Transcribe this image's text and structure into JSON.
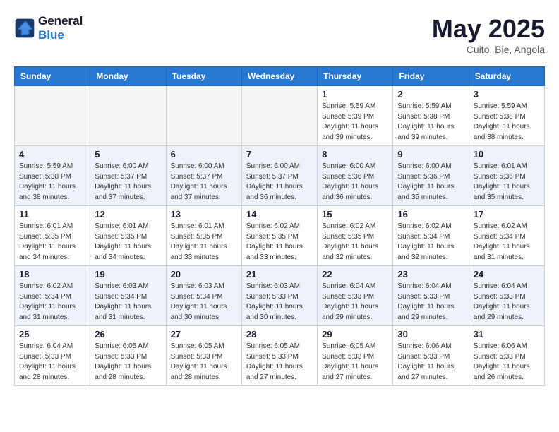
{
  "header": {
    "logo_line1": "General",
    "logo_line2": "Blue",
    "month_year": "May 2025",
    "location": "Cuito, Bie, Angola"
  },
  "weekdays": [
    "Sunday",
    "Monday",
    "Tuesday",
    "Wednesday",
    "Thursday",
    "Friday",
    "Saturday"
  ],
  "rows": [
    {
      "alt": false,
      "cells": [
        {
          "empty": true
        },
        {
          "empty": true
        },
        {
          "empty": true
        },
        {
          "empty": true
        },
        {
          "day": "1",
          "info": "Sunrise: 5:59 AM\nSunset: 5:39 PM\nDaylight: 11 hours\nand 39 minutes."
        },
        {
          "day": "2",
          "info": "Sunrise: 5:59 AM\nSunset: 5:38 PM\nDaylight: 11 hours\nand 39 minutes."
        },
        {
          "day": "3",
          "info": "Sunrise: 5:59 AM\nSunset: 5:38 PM\nDaylight: 11 hours\nand 38 minutes."
        }
      ]
    },
    {
      "alt": true,
      "cells": [
        {
          "day": "4",
          "info": "Sunrise: 5:59 AM\nSunset: 5:38 PM\nDaylight: 11 hours\nand 38 minutes."
        },
        {
          "day": "5",
          "info": "Sunrise: 6:00 AM\nSunset: 5:37 PM\nDaylight: 11 hours\nand 37 minutes."
        },
        {
          "day": "6",
          "info": "Sunrise: 6:00 AM\nSunset: 5:37 PM\nDaylight: 11 hours\nand 37 minutes."
        },
        {
          "day": "7",
          "info": "Sunrise: 6:00 AM\nSunset: 5:37 PM\nDaylight: 11 hours\nand 36 minutes."
        },
        {
          "day": "8",
          "info": "Sunrise: 6:00 AM\nSunset: 5:36 PM\nDaylight: 11 hours\nand 36 minutes."
        },
        {
          "day": "9",
          "info": "Sunrise: 6:00 AM\nSunset: 5:36 PM\nDaylight: 11 hours\nand 35 minutes."
        },
        {
          "day": "10",
          "info": "Sunrise: 6:01 AM\nSunset: 5:36 PM\nDaylight: 11 hours\nand 35 minutes."
        }
      ]
    },
    {
      "alt": false,
      "cells": [
        {
          "day": "11",
          "info": "Sunrise: 6:01 AM\nSunset: 5:35 PM\nDaylight: 11 hours\nand 34 minutes."
        },
        {
          "day": "12",
          "info": "Sunrise: 6:01 AM\nSunset: 5:35 PM\nDaylight: 11 hours\nand 34 minutes."
        },
        {
          "day": "13",
          "info": "Sunrise: 6:01 AM\nSunset: 5:35 PM\nDaylight: 11 hours\nand 33 minutes."
        },
        {
          "day": "14",
          "info": "Sunrise: 6:02 AM\nSunset: 5:35 PM\nDaylight: 11 hours\nand 33 minutes."
        },
        {
          "day": "15",
          "info": "Sunrise: 6:02 AM\nSunset: 5:35 PM\nDaylight: 11 hours\nand 32 minutes."
        },
        {
          "day": "16",
          "info": "Sunrise: 6:02 AM\nSunset: 5:34 PM\nDaylight: 11 hours\nand 32 minutes."
        },
        {
          "day": "17",
          "info": "Sunrise: 6:02 AM\nSunset: 5:34 PM\nDaylight: 11 hours\nand 31 minutes."
        }
      ]
    },
    {
      "alt": true,
      "cells": [
        {
          "day": "18",
          "info": "Sunrise: 6:02 AM\nSunset: 5:34 PM\nDaylight: 11 hours\nand 31 minutes."
        },
        {
          "day": "19",
          "info": "Sunrise: 6:03 AM\nSunset: 5:34 PM\nDaylight: 11 hours\nand 31 minutes."
        },
        {
          "day": "20",
          "info": "Sunrise: 6:03 AM\nSunset: 5:34 PM\nDaylight: 11 hours\nand 30 minutes."
        },
        {
          "day": "21",
          "info": "Sunrise: 6:03 AM\nSunset: 5:33 PM\nDaylight: 11 hours\nand 30 minutes."
        },
        {
          "day": "22",
          "info": "Sunrise: 6:04 AM\nSunset: 5:33 PM\nDaylight: 11 hours\nand 29 minutes."
        },
        {
          "day": "23",
          "info": "Sunrise: 6:04 AM\nSunset: 5:33 PM\nDaylight: 11 hours\nand 29 minutes."
        },
        {
          "day": "24",
          "info": "Sunrise: 6:04 AM\nSunset: 5:33 PM\nDaylight: 11 hours\nand 29 minutes."
        }
      ]
    },
    {
      "alt": false,
      "cells": [
        {
          "day": "25",
          "info": "Sunrise: 6:04 AM\nSunset: 5:33 PM\nDaylight: 11 hours\nand 28 minutes."
        },
        {
          "day": "26",
          "info": "Sunrise: 6:05 AM\nSunset: 5:33 PM\nDaylight: 11 hours\nand 28 minutes."
        },
        {
          "day": "27",
          "info": "Sunrise: 6:05 AM\nSunset: 5:33 PM\nDaylight: 11 hours\nand 28 minutes."
        },
        {
          "day": "28",
          "info": "Sunrise: 6:05 AM\nSunset: 5:33 PM\nDaylight: 11 hours\nand 27 minutes."
        },
        {
          "day": "29",
          "info": "Sunrise: 6:05 AM\nSunset: 5:33 PM\nDaylight: 11 hours\nand 27 minutes."
        },
        {
          "day": "30",
          "info": "Sunrise: 6:06 AM\nSunset: 5:33 PM\nDaylight: 11 hours\nand 27 minutes."
        },
        {
          "day": "31",
          "info": "Sunrise: 6:06 AM\nSunset: 5:33 PM\nDaylight: 11 hours\nand 26 minutes."
        }
      ]
    }
  ]
}
